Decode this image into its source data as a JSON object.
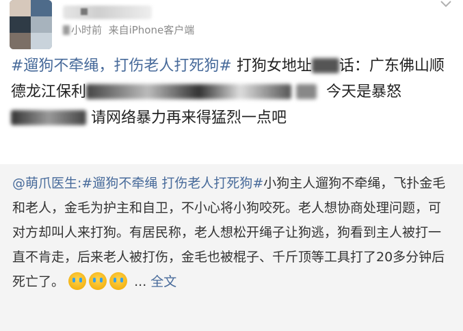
{
  "post": {
    "meta_time": "小时前",
    "meta_source_prefix": "来自",
    "meta_source": "iPhone客户端",
    "hashtag": "#遛狗不牵绳，打伤老人打死狗#",
    "text_part1": "打狗女地址",
    "text_part2": "话：广东佛山顺德龙江保利",
    "text_part3": "今天是暴怒",
    "text_part4": "请网络暴力再来得猛烈一点吧"
  },
  "repost": {
    "mention": "@萌爪医生:",
    "hashtag": "#遛狗不牵绳 打伤老人打死狗#",
    "body": "小狗主人遛狗不牵绳，飞扑金毛和老人，金毛为护主和自卫，不小心将小狗咬死。老人想协商处理问题，可对方却叫人来打狗。有居民称，老人想松开绳子让狗逃，狗看到主人被打一直不肯走，后来老人被打伤，金毛也被棍子、千斤顶等工具打了20多分钟后死亡了。",
    "ellipsis": "...",
    "full_text": "全文",
    "emoji_names": [
      "crying-face-icon",
      "crying-face-icon",
      "crying-face-icon"
    ]
  },
  "colors": {
    "link": "#476a9a",
    "repost_bg": "#f4f4f4",
    "meta": "#8a8a8a"
  }
}
